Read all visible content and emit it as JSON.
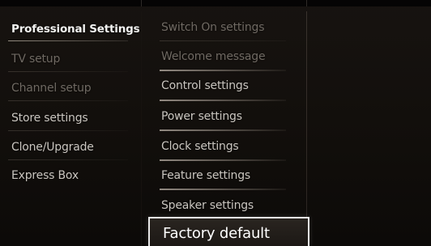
{
  "left_menu": {
    "items": [
      {
        "label": "Professional Settings",
        "state": "active"
      },
      {
        "label": "TV setup",
        "state": "dim"
      },
      {
        "label": "Channel setup",
        "state": "dim"
      },
      {
        "label": "Store settings",
        "state": "normal"
      },
      {
        "label": "Clone/Upgrade",
        "state": "normal"
      },
      {
        "label": "Express Box",
        "state": "normal"
      }
    ]
  },
  "right_menu": {
    "items": [
      {
        "label": "Switch On settings",
        "state": "dim"
      },
      {
        "label": "Welcome message",
        "state": "dim"
      },
      {
        "label": "Control settings",
        "state": "normal"
      },
      {
        "label": "Power settings",
        "state": "normal"
      },
      {
        "label": "Clock settings",
        "state": "normal"
      },
      {
        "label": "Feature settings",
        "state": "normal"
      },
      {
        "label": "Speaker settings",
        "state": "normal"
      }
    ],
    "selected": {
      "label": "Factory default"
    }
  },
  "colors": {
    "background": "#120f0c",
    "text_active": "#f2f2f0",
    "text_normal": "#c9c5bf",
    "text_dim": "#6f6962",
    "highlight_border": "#e8e8e8"
  }
}
